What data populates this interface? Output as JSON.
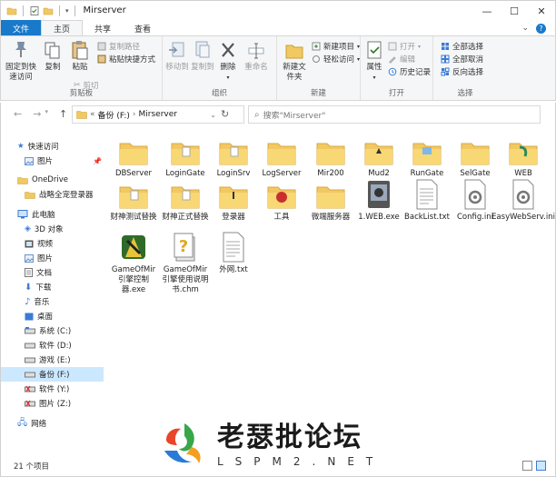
{
  "window": {
    "title": "Mirserver"
  },
  "tabs": [
    {
      "label": "文件"
    },
    {
      "label": "主页"
    },
    {
      "label": "共享"
    },
    {
      "label": "查看"
    }
  ],
  "ribbon": {
    "clipboard": {
      "pin_label": "固定到快速访问",
      "copy_label": "复制",
      "paste_label": "粘贴",
      "cut_label": "剪切",
      "copy_path_label": "复制路径",
      "paste_shortcut_label": "粘贴快捷方式",
      "group_label": "剪贴板"
    },
    "organize": {
      "move_to_label": "移动到",
      "copy_to_label": "复制到",
      "delete_label": "删除",
      "rename_label": "重命名",
      "group_label": "组织"
    },
    "new": {
      "new_folder_label": "新建文件夹",
      "new_item_label": "新建项目",
      "easy_access_label": "轻松访问",
      "group_label": "新建"
    },
    "open": {
      "properties_label": "属性",
      "open_label": "打开",
      "edit_label": "编辑",
      "history_label": "历史记录",
      "group_label": "打开"
    },
    "select": {
      "select_all_label": "全部选择",
      "select_none_label": "全部取消",
      "invert_label": "反向选择",
      "group_label": "选择"
    }
  },
  "address": {
    "crumb_1": "备份 (F:)",
    "crumb_2": "Mirserver",
    "search_placeholder": "搜索\"Mirserver\""
  },
  "sidebar": {
    "items": [
      {
        "label": "快速访问"
      },
      {
        "label": "图片"
      },
      {
        "label": "OneDrive"
      },
      {
        "label": "战略全宠登录器"
      },
      {
        "label": "此电脑"
      },
      {
        "label": "3D 对象"
      },
      {
        "label": "视频"
      },
      {
        "label": "图片"
      },
      {
        "label": "文档"
      },
      {
        "label": "下载"
      },
      {
        "label": "音乐"
      },
      {
        "label": "桌面"
      },
      {
        "label": "系统 (C:)"
      },
      {
        "label": "软件 (D:)"
      },
      {
        "label": "游戏 (E:)"
      },
      {
        "label": "备份 (F:)"
      },
      {
        "label": "软件 (Y:)"
      },
      {
        "label": "图片 (Z:)"
      },
      {
        "label": "网络"
      }
    ]
  },
  "files": [
    {
      "name": "DBServer",
      "icon": "folder-icon"
    },
    {
      "name": "LoginGate",
      "icon": "folder-icon"
    },
    {
      "name": "LoginSrv",
      "icon": "folder-icon"
    },
    {
      "name": "LogServer",
      "icon": "folder-icon"
    },
    {
      "name": "Mir200",
      "icon": "folder-icon"
    },
    {
      "name": "Mud2",
      "icon": "folder-icon"
    },
    {
      "name": "RunGate",
      "icon": "folder-icon"
    },
    {
      "name": "SelGate",
      "icon": "folder-icon"
    },
    {
      "name": "WEB",
      "icon": "folder-icon"
    },
    {
      "name": "财神测试替换",
      "icon": "folder-icon"
    },
    {
      "name": "财神正式替换",
      "icon": "folder-icon"
    },
    {
      "name": "登录器",
      "icon": "folder-icon"
    },
    {
      "name": "工具",
      "icon": "folder-icon"
    },
    {
      "name": "微端服务器",
      "icon": "folder-icon"
    },
    {
      "name": "1.WEB.exe",
      "icon": "exe-icon"
    },
    {
      "name": "BackList.txt",
      "icon": "text-file-icon"
    },
    {
      "name": "Config.ini",
      "icon": "ini-file-icon"
    },
    {
      "name": "EasyWebServ.ini",
      "icon": "ini-file-icon"
    },
    {
      "name": "GameOfMir引擎控制器.exe",
      "icon": "exe-icon"
    },
    {
      "name": "GameOfMir引擎使用说明书.chm",
      "icon": "help-file-icon"
    },
    {
      "name": "外网.txt",
      "icon": "text-file-icon"
    }
  ],
  "status": {
    "count": "21 个项目"
  },
  "watermark": {
    "title": "老瑟批论坛",
    "domain": "LSPM2.NET"
  },
  "colors": {
    "accent": "#1979ca",
    "folder": "#f2c862",
    "selection": "#cce8ff"
  }
}
